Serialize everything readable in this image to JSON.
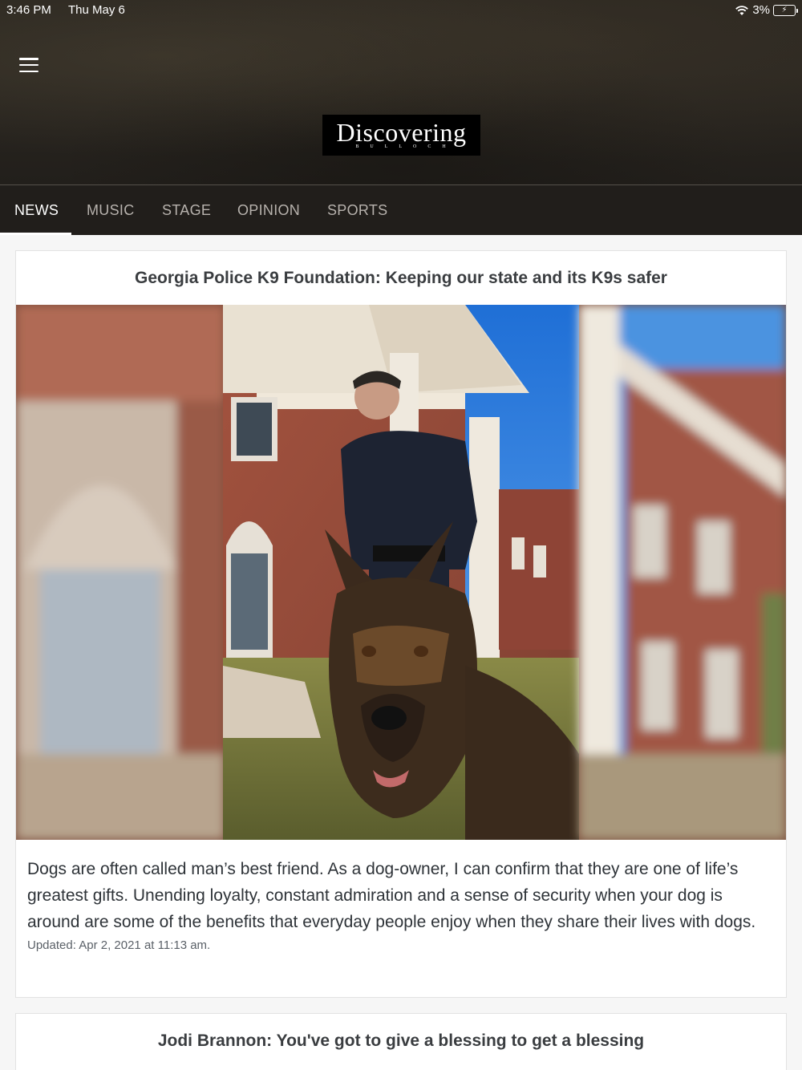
{
  "status_bar": {
    "time": "3:46 PM",
    "date": "Thu May 6",
    "battery": "3%",
    "wifi_icon": "wifi-icon",
    "battery_icon": "battery-charging-icon"
  },
  "header": {
    "menu_icon": "hamburger-menu-icon",
    "logo_text": "Discovering",
    "logo_subtext": "BULLOCH"
  },
  "nav": {
    "tabs": [
      {
        "label": "NEWS",
        "active": true
      },
      {
        "label": "MUSIC",
        "active": false
      },
      {
        "label": "STAGE",
        "active": false
      },
      {
        "label": "OPINION",
        "active": false
      },
      {
        "label": "SPORTS",
        "active": false
      }
    ]
  },
  "articles": [
    {
      "title": "Georgia Police  K9 Foundation: Keeping our state and its K9s safer",
      "summary": "Dogs are often called man’s best friend. As a dog-owner, I can confirm that they are one of life’s greatest gifts. Unending loyalty, constant admiration and a sense of security when your dog is around are some of the benefits that everyday people enjoy when they share their lives with dogs.",
      "updated": "Updated: Apr 2, 2021 at 11:13 am."
    },
    {
      "title": "Jodi Brannon: You've got to give a blessing to get a blessing"
    }
  ],
  "colors": {
    "nav_bg": "#211e1b",
    "nav_active": "#ffffff",
    "nav_inactive": "#b7b2ad",
    "title_text": "#3a3d40"
  }
}
